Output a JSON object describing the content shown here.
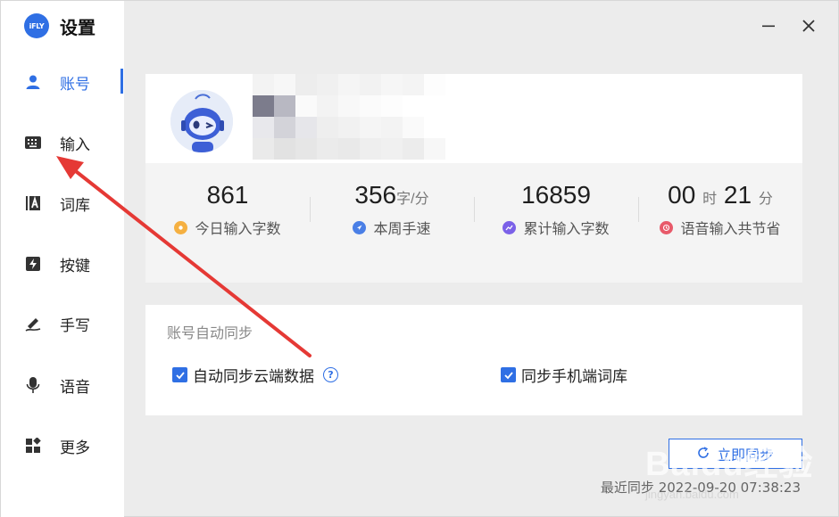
{
  "app": {
    "title": "设置",
    "logo_text": "iFLY"
  },
  "sidebar": {
    "items": [
      {
        "label": "账号",
        "icon": "user-icon",
        "active": true
      },
      {
        "label": "输入",
        "icon": "keyboard-icon"
      },
      {
        "label": "词库",
        "icon": "dictionary-icon"
      },
      {
        "label": "按键",
        "icon": "lightning-icon"
      },
      {
        "label": "手写",
        "icon": "pen-icon"
      },
      {
        "label": "语音",
        "icon": "microphone-icon"
      },
      {
        "label": "更多",
        "icon": "grid-icon"
      }
    ]
  },
  "window_controls": {
    "minimize": "—",
    "close": "✕"
  },
  "profile": {
    "name_blurred": true,
    "stats": [
      {
        "value": "861",
        "label": "今日输入字数",
        "icon": "sun-icon",
        "color": "#f5b041"
      },
      {
        "value": "356",
        "unit": "字/分",
        "label": "本周手速",
        "icon": "rocket-icon",
        "color": "#4a7fe6"
      },
      {
        "value": "16859",
        "label": "累计输入字数",
        "icon": "trend-icon",
        "color": "#7b61e8"
      },
      {
        "value_hours": "00",
        "unit_hours": "时",
        "value_minutes": "21",
        "unit_minutes": "分",
        "label": "语音输入共节省",
        "icon": "clock-icon",
        "color": "#e85a6a"
      }
    ]
  },
  "sync": {
    "title": "账号自动同步",
    "options": [
      {
        "label": "自动同步云端数据",
        "checked": true
      },
      {
        "label": "同步手机端词库",
        "checked": true
      }
    ],
    "button_label": "立即同步",
    "last_sync": "最近同步 2022-09-20 07:38:23"
  },
  "watermark": {
    "text": "Baidu经验",
    "sub": "jingyan.baidu.com"
  },
  "colors": {
    "accent": "#2f6fe4",
    "annotation": "#e53935"
  }
}
